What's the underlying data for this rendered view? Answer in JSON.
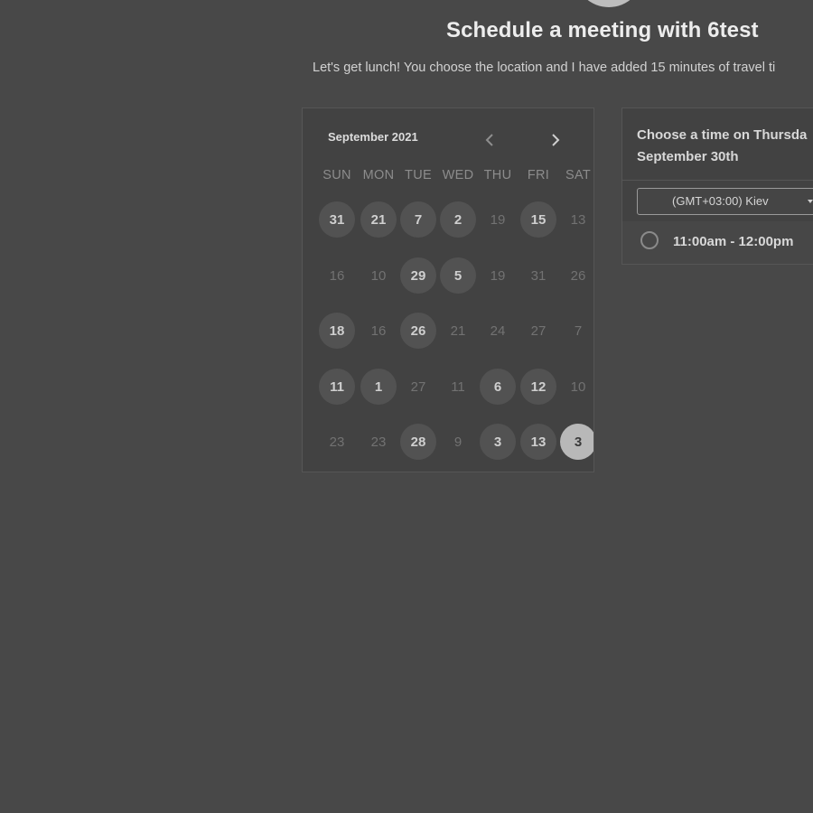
{
  "header": {
    "title": "Schedule a meeting with 6test",
    "subtitle": "Let's get lunch! You choose the location and I have added 15 minutes of travel ti"
  },
  "calendar": {
    "month_label": "September 2021",
    "weekdays": [
      "SUN",
      "MON",
      "TUE",
      "WED",
      "THU",
      "FRI",
      "SAT"
    ],
    "weeks": [
      [
        {
          "label": "31",
          "state": "available"
        },
        {
          "label": "21",
          "state": "available"
        },
        {
          "label": "7",
          "state": "available"
        },
        {
          "label": "2",
          "state": "available"
        },
        {
          "label": "19",
          "state": "unavailable"
        },
        {
          "label": "15",
          "state": "available"
        },
        {
          "label": "13",
          "state": "unavailable"
        }
      ],
      [
        {
          "label": "16",
          "state": "unavailable"
        },
        {
          "label": "10",
          "state": "unavailable"
        },
        {
          "label": "29",
          "state": "available"
        },
        {
          "label": "5",
          "state": "available"
        },
        {
          "label": "19",
          "state": "unavailable"
        },
        {
          "label": "31",
          "state": "unavailable"
        },
        {
          "label": "26",
          "state": "unavailable"
        }
      ],
      [
        {
          "label": "18",
          "state": "available"
        },
        {
          "label": "16",
          "state": "unavailable"
        },
        {
          "label": "26",
          "state": "available"
        },
        {
          "label": "21",
          "state": "unavailable"
        },
        {
          "label": "24",
          "state": "unavailable"
        },
        {
          "label": "27",
          "state": "unavailable"
        },
        {
          "label": "7",
          "state": "unavailable"
        }
      ],
      [
        {
          "label": "11",
          "state": "available"
        },
        {
          "label": "1",
          "state": "available"
        },
        {
          "label": "27",
          "state": "unavailable"
        },
        {
          "label": "11",
          "state": "unavailable"
        },
        {
          "label": "6",
          "state": "available"
        },
        {
          "label": "12",
          "state": "available"
        },
        {
          "label": "10",
          "state": "unavailable"
        }
      ],
      [
        {
          "label": "23",
          "state": "unavailable"
        },
        {
          "label": "23",
          "state": "unavailable"
        },
        {
          "label": "28",
          "state": "available"
        },
        {
          "label": "9",
          "state": "unavailable"
        },
        {
          "label": "3",
          "state": "available"
        },
        {
          "label": "13",
          "state": "available"
        },
        {
          "label": "3",
          "state": "selected"
        }
      ]
    ]
  },
  "time_panel": {
    "heading_line1": "Choose a time on Thursda",
    "heading_line2": "September 30th",
    "timezone": "(GMT+03:00) Kiev",
    "slots": [
      {
        "label": "11:00am - 12:00pm"
      }
    ]
  },
  "icons": {
    "prev": "chevron-left-icon",
    "next": "chevron-right-icon",
    "timezone_caret": "caret-down-icon"
  }
}
